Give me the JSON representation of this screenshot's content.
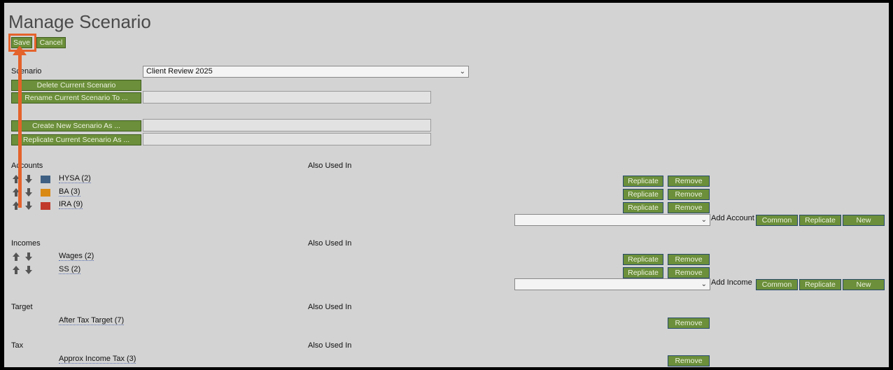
{
  "page": {
    "title": "Manage Scenario"
  },
  "toolbar": {
    "save_label": "Save",
    "cancel_label": "Cancel"
  },
  "scenario": {
    "label": "Scenario",
    "selected": "Client Review 2025",
    "delete_label": "Delete Current Scenario",
    "rename_label": "Rename Current Scenario To ...",
    "create_label": "Create New Scenario As ...",
    "replicate_label": "Replicate Current Scenario As ..."
  },
  "accounts": {
    "header": "Accounts",
    "also_used_in": "Also Used In",
    "items": [
      {
        "name": "HYSA (2)",
        "color": "#3e5f82"
      },
      {
        "name": "BA (3)",
        "color": "#d98a14"
      },
      {
        "name": "IRA (9)",
        "color": "#c0392b"
      }
    ],
    "add_label": "Add Account",
    "common_label": "Common",
    "replicate_label": "Replicate",
    "new_label": "New"
  },
  "incomes": {
    "header": "Incomes",
    "also_used_in": "Also Used In",
    "items": [
      {
        "name": "Wages (2)"
      },
      {
        "name": "SS (2)"
      }
    ],
    "add_label": "Add Income",
    "common_label": "Common",
    "replicate_label": "Replicate",
    "new_label": "New"
  },
  "target": {
    "header": "Target",
    "also_used_in": "Also Used In",
    "item": "After Tax Target (7)"
  },
  "tax": {
    "header": "Tax",
    "also_used_in": "Also Used In",
    "item": "Approx Income Tax (3)"
  },
  "row_actions": {
    "replicate": "Replicate",
    "remove": "Remove"
  },
  "colors": {
    "button": "#6b8f3a",
    "highlight": "#e4622b",
    "background": "#d3d3d3"
  }
}
